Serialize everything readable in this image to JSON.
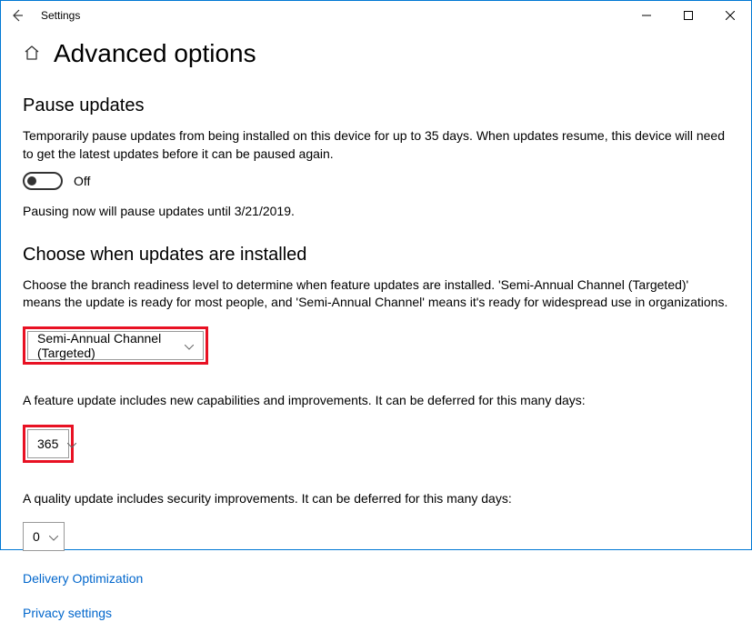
{
  "window": {
    "title": "Settings"
  },
  "page": {
    "heading": "Advanced options"
  },
  "pause": {
    "heading": "Pause updates",
    "description": "Temporarily pause updates from being installed on this device for up to 35 days. When updates resume, this device will need to get the latest updates before it can be paused again.",
    "toggle_state": "Off",
    "status": "Pausing now will pause updates until 3/21/2019."
  },
  "channel": {
    "heading": "Choose when updates are installed",
    "description": "Choose the branch readiness level to determine when feature updates are installed. 'Semi-Annual Channel (Targeted)' means the update is ready for most people, and 'Semi-Annual Channel' means it's ready for widespread use in organizations.",
    "selected": "Semi-Annual Channel (Targeted)"
  },
  "feature_defer": {
    "description": "A feature update includes new capabilities and improvements. It can be deferred for this many days:",
    "value": "365"
  },
  "quality_defer": {
    "description": "A quality update includes security improvements. It can be deferred for this many days:",
    "value": "0"
  },
  "links": {
    "delivery": "Delivery Optimization",
    "privacy": "Privacy settings"
  }
}
